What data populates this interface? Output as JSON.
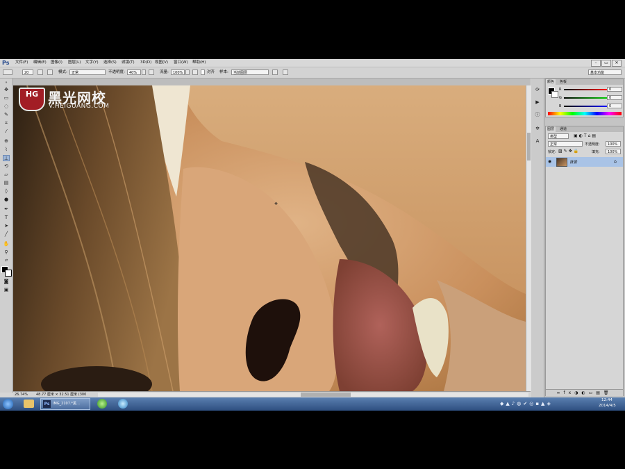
{
  "menubar": {
    "app_logo": "Ps",
    "items": [
      "文件(F)",
      "编辑(E)",
      "图像(I)",
      "图层(L)",
      "文字(Y)",
      "选择(S)",
      "滤镜(T)",
      "3D(D)",
      "视图(V)",
      "窗口(W)",
      "帮助(H)"
    ],
    "window_controls": [
      "–",
      "▭",
      "✕"
    ]
  },
  "options_bar": {
    "brush_size": "20",
    "mode_label": "模式:",
    "mode_value": "正常",
    "opacity_label": "不透明度:",
    "opacity_value": "40%",
    "flow_label": "流量:",
    "flow_value": "100%",
    "align_label": "对齐",
    "sample_label": "样本:",
    "sample_value": "当前图层",
    "workspace_value": "基本功能"
  },
  "watermark": {
    "badge": "HG",
    "cn_name": "黑光网校",
    "url": "V.HEIGUANG.COM"
  },
  "status_bar": {
    "zoom": "26.74%",
    "doc_info": "48.77 厘米 × 32.51 厘米 (300"
  },
  "color_panel": {
    "tabs": [
      "颜色",
      "色板"
    ],
    "channels": [
      {
        "label": "R",
        "value": "0"
      },
      {
        "label": "G",
        "value": "0"
      },
      {
        "label": "B",
        "value": "0"
      }
    ]
  },
  "layers_panel": {
    "tabs": [
      "图层",
      "通道"
    ],
    "kind_filter": "类型",
    "blend_mode": "正常",
    "opacity_label": "不透明度:",
    "opacity_value": "100%",
    "lock_label": "锁定:",
    "fill_label": "填充:",
    "fill_value": "100%",
    "layers": [
      {
        "name": "背景",
        "locked": true,
        "visible": true,
        "selected": true
      }
    ]
  },
  "taskbar": {
    "active_window": "IMG_2107.*黑…",
    "clock_time": "12:44",
    "clock_date": "2014/4/5"
  },
  "colors": {
    "accent_selected_layer": "#a9c3e6",
    "taskbar": "#3a5f95",
    "skin": "#c89464"
  }
}
